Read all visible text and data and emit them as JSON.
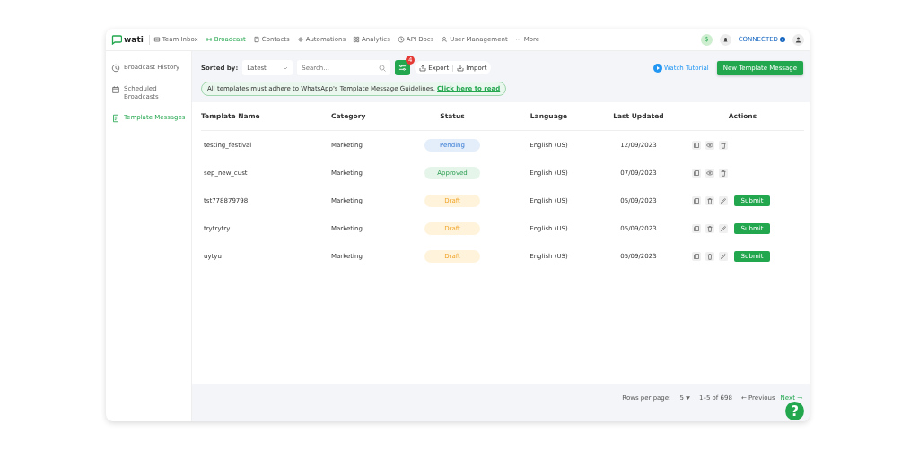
{
  "brand": {
    "name": "wati"
  },
  "nav": [
    {
      "label": "Team Inbox",
      "selected": false
    },
    {
      "label": "Broadcast",
      "selected": true
    },
    {
      "label": "Contacts",
      "selected": false
    },
    {
      "label": "Automations",
      "selected": false
    },
    {
      "label": "Analytics",
      "selected": false
    },
    {
      "label": "API Docs",
      "selected": false
    },
    {
      "label": "User Management",
      "selected": false
    },
    {
      "label": "More",
      "selected": false
    }
  ],
  "balance": {
    "label": "$"
  },
  "status": {
    "label": "CONNECTED"
  },
  "sidebar": {
    "items": [
      {
        "label": "Broadcast History",
        "selected": false
      },
      {
        "label": "Scheduled Broadcasts",
        "selected": false
      },
      {
        "label": "Template Messages",
        "selected": true
      }
    ]
  },
  "toolbar": {
    "sort_label": "Sorted by:",
    "sort_value": "Latest",
    "search_placeholder": "Search...",
    "filter_badge": "4",
    "export": "Export",
    "import": "Import",
    "tutorial": "Watch Tutorial",
    "new_button": "New Template Message"
  },
  "notice": {
    "text": "All templates must adhere to WhatsApp's Template Message Guidelines.",
    "link": "Click here to read"
  },
  "table": {
    "columns": [
      "Template Name",
      "Category",
      "Status",
      "Language",
      "Last Updated",
      "Actions"
    ],
    "rows": [
      {
        "name": "testing_festival",
        "category": "Marketing",
        "status": {
          "label": "Pending",
          "kind": "pending"
        },
        "language": "English (US)",
        "updated": "12/09/2023",
        "actions": [
          {
            "kind": "copy"
          },
          {
            "kind": "view"
          },
          {
            "kind": "delete"
          }
        ]
      },
      {
        "name": "sep_new_cust",
        "category": "Marketing",
        "status": {
          "label": "Approved",
          "kind": "approved"
        },
        "language": "English (US)",
        "updated": "07/09/2023",
        "actions": [
          {
            "kind": "copy"
          },
          {
            "kind": "view"
          },
          {
            "kind": "delete"
          }
        ]
      },
      {
        "name": "tst778879798",
        "category": "Marketing",
        "status": {
          "label": "Draft",
          "kind": "draft"
        },
        "language": "English (US)",
        "updated": "05/09/2023",
        "actions": [
          {
            "kind": "copy"
          },
          {
            "kind": "delete"
          },
          {
            "kind": "edit"
          },
          {
            "kind": "submit",
            "label": "Submit"
          }
        ]
      },
      {
        "name": "trytrytry",
        "category": "Marketing",
        "status": {
          "label": "Draft",
          "kind": "draft"
        },
        "language": "English (US)",
        "updated": "05/09/2023",
        "actions": [
          {
            "kind": "copy"
          },
          {
            "kind": "delete"
          },
          {
            "kind": "edit"
          },
          {
            "kind": "submit",
            "label": "Submit"
          }
        ]
      },
      {
        "name": "uytyu",
        "category": "Marketing",
        "status": {
          "label": "Draft",
          "kind": "draft"
        },
        "language": "English (US)",
        "updated": "05/09/2023",
        "actions": [
          {
            "kind": "copy"
          },
          {
            "kind": "delete"
          },
          {
            "kind": "edit"
          },
          {
            "kind": "submit",
            "label": "Submit"
          }
        ]
      }
    ]
  },
  "pagination": {
    "rows_label": "Rows per page:",
    "rows_value": "5",
    "range": "1–5 of 698",
    "previous": "← Previous",
    "next": "Next →"
  },
  "help": {
    "label": "?"
  }
}
